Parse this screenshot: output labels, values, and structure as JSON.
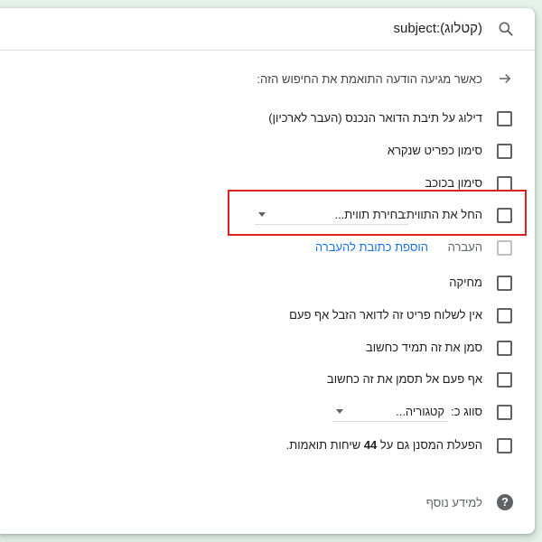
{
  "search": {
    "query": "(קטלוג):subject",
    "icon": "search-icon"
  },
  "header": {
    "arrow_icon": "arrow-right-icon",
    "label": "כאשר מגיעה הודעה התואמת את החיפוש הזה:"
  },
  "options": {
    "skip_inbox": "דילוג על תיבת הדואר הנכנס (העבר לארכיון)",
    "mark_read": "סימון כפריט שנקרא",
    "star": "סימון בכוכב",
    "apply_label": "החל את התווית:",
    "apply_label_select": "בחירת תווית...",
    "forward": "העברה",
    "forward_link": "הוספת כתובת להעברה",
    "delete": "מחיקה",
    "never_spam": "אין לשלוח פריט זה לדואר הזבל אף פעם",
    "always_important": "סמן את זה תמיד כחשוב",
    "never_important": "אף פעם אל תסמן את זה כחשוב",
    "categorize": "סווג כ:",
    "categorize_select": "קטגוריה...",
    "also_apply_prefix": "הפעלת המסנן גם על",
    "also_apply_count": "44",
    "also_apply_suffix": "שיחות תואמות."
  },
  "help": {
    "icon": "help-icon",
    "label": "למידע נוסף"
  },
  "colors": {
    "highlight": "#e02020",
    "link": "#1a73e8",
    "panel_background": "#ffffff",
    "page_background": "#e6f2ea"
  }
}
